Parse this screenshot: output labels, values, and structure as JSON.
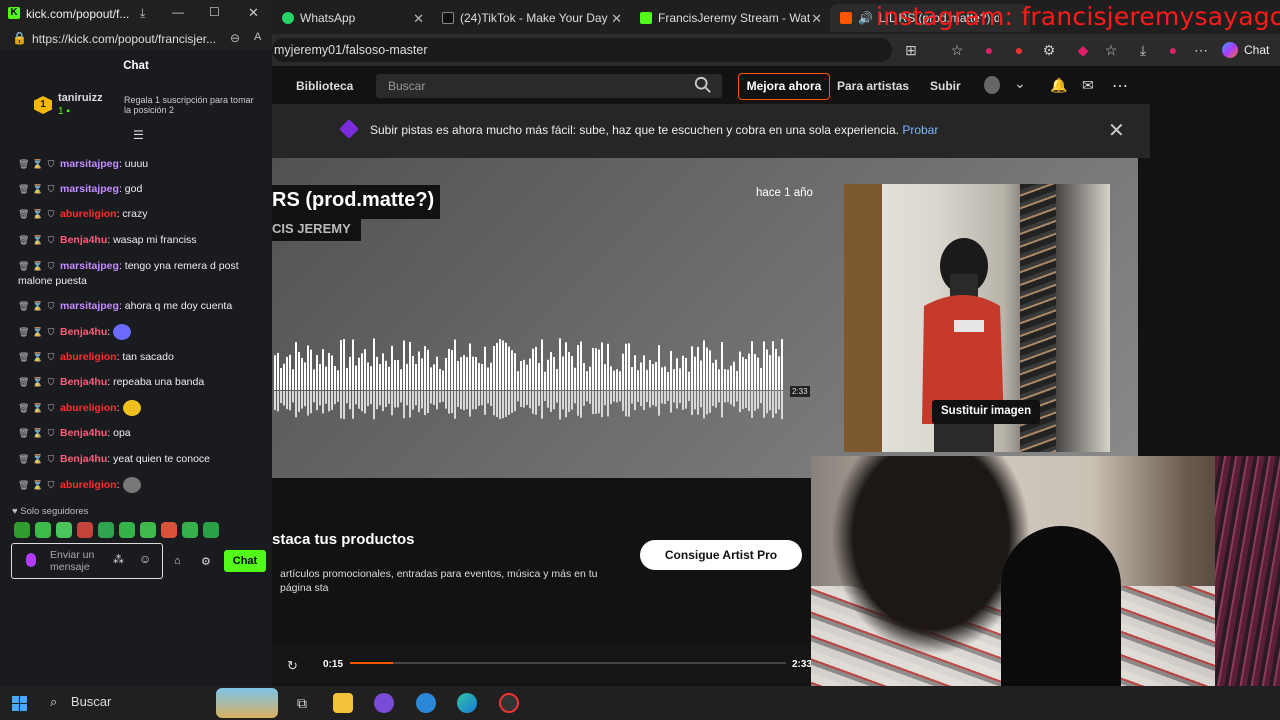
{
  "kick_window": {
    "title": "kick.com/popout/f...",
    "url": "https://kick.com/popout/francisjer...",
    "header": "Chat",
    "pinned": {
      "username": "taniruizz",
      "position": "1",
      "message": "Regala 1 suscripción para tomar la posición 2"
    },
    "messages": [
      {
        "user": "marsitajpeg",
        "color": "#c58cff",
        "text": ": uuuu"
      },
      {
        "user": "marsitajpeg",
        "color": "#c58cff",
        "text": ": god"
      },
      {
        "user": "abureligion",
        "color": "#ff2d2d",
        "text": ": crazy"
      },
      {
        "user": "Benja4hu",
        "color": "#ff5c7a",
        "text": ": wasap mi franciss"
      },
      {
        "user": "marsitajpeg",
        "color": "#c58cff",
        "text": ": tengo yna remera d post malone puesta"
      },
      {
        "user": "marsitajpeg",
        "color": "#c58cff",
        "text": ": ahora q me doy cuenta"
      },
      {
        "user": "Benja4hu",
        "color": "#ff5c7a",
        "text": ":"
      },
      {
        "user": "abureligion",
        "color": "#ff2d2d",
        "text": ": tan sacado"
      },
      {
        "user": "Benja4hu",
        "color": "#ff5c7a",
        "text": ": repeaba una banda"
      },
      {
        "user": "abureligion",
        "color": "#ff2d2d",
        "text": ":"
      },
      {
        "user": "Benja4hu",
        "color": "#ff5c7a",
        "text": ": opa"
      },
      {
        "user": "Benja4hu",
        "color": "#ff5c7a",
        "text": ": yeat quien te conoce"
      },
      {
        "user": "abureligion",
        "color": "#ff2d2d",
        "text": ":"
      }
    ],
    "followers_only": "Solo seguidores",
    "input_placeholder": "Enviar un mensaje",
    "send_label": "Chat"
  },
  "browser": {
    "tabs": [
      {
        "label": "WhatsApp",
        "color": "#25d366"
      },
      {
        "label": "(24)TikTok - Make Your Day",
        "color": "#ffffff"
      },
      {
        "label": "FrancisJeremy Stream - Watch Live",
        "color": "#53fc18"
      },
      {
        "label": "LIL RS (prod.matte?) de Fran",
        "color": "#ff5500"
      }
    ],
    "address": "myjeremy01/falsoso-master",
    "copilot_label": "Chat"
  },
  "overlay_watermark": "instagram: francisjeremysayago",
  "soundcloud": {
    "nav": {
      "library": "Biblioteca",
      "search_placeholder": "Buscar",
      "upgrade": "Mejora ahora",
      "for_artists": "Para artistas",
      "upload": "Subir"
    },
    "banner": {
      "text": "Subir pistas es ahora mucho más fácil: sube, haz que te escuchen y cobra en una sola experiencia.",
      "link": "Probar"
    },
    "track": {
      "title": "RS (prod.matte?)",
      "artist": "CIS JEREMY",
      "posted": "hace 1 año",
      "duration_label": "2:33",
      "replace_image": "Sustituir imagen"
    },
    "promo": {
      "title": "staca tus productos",
      "text": "artículos promocionales, entradas para eventos, música y más en tu página sta",
      "button": "Consigue Artist Pro"
    },
    "player": {
      "elapsed": "0:15",
      "total": "2:33",
      "progress": 0.098
    }
  },
  "taskbar": {
    "search_label": "Buscar"
  }
}
